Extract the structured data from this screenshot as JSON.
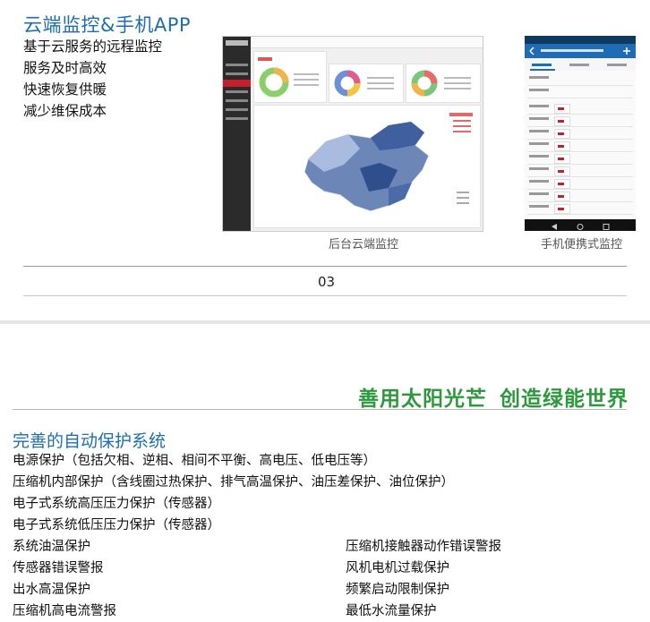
{
  "cloud": {
    "title": "云端监控&手机APP",
    "features": [
      "基于云服务的远程监控",
      "服务及时高效",
      "快速恢复供暖",
      "减少维保成本"
    ],
    "dashboard_caption": "后台云端监控",
    "phone_caption": "手机便携式监控"
  },
  "page_number": "03",
  "slogan": {
    "part1": "善用太阳光芒",
    "part2": "创造绿能世界"
  },
  "protection": {
    "title": "完善的自动保护系统",
    "full_lines": [
      "电源保护（包括欠相、逆相、相间不平衡、高电压、低电压等）",
      "压缩机内部保护（含线圈过热保护、排气高温保护、油压差保护、油位保护）",
      "电子式系统高压压力保护（传感器）",
      "电子式系统低压压力保护（传感器）"
    ],
    "left_col": [
      "系统油温保护",
      "传感器错误警报",
      "出水高温保护",
      "压缩机高电流警报"
    ],
    "right_col": [
      "压缩机接触器动作错误警报",
      "风机电机过载保护",
      "频繁启动限制保护",
      "最低水流量保护"
    ]
  },
  "colors": {
    "title_blue": "#1e6db4",
    "slogan_green": "#2c9a3c",
    "accent_red": "#c81e2c"
  }
}
